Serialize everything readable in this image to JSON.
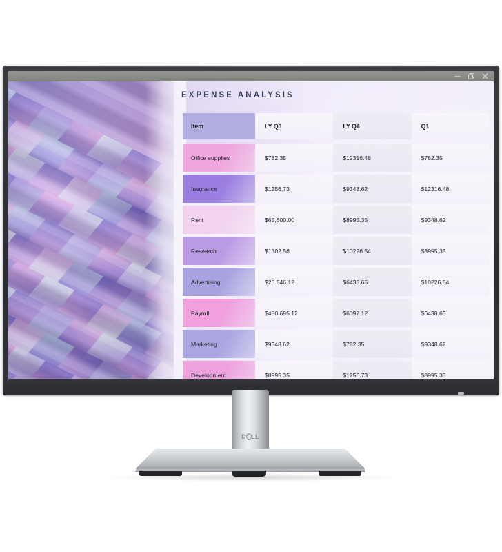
{
  "product": {
    "brand": "DELL",
    "device_name": "monitor"
  },
  "window": {
    "controls": [
      {
        "name": "minimize",
        "glyph": "minimize-icon"
      },
      {
        "name": "maximize",
        "glyph": "maximize-icon"
      },
      {
        "name": "close",
        "glyph": "close-icon"
      }
    ]
  },
  "document": {
    "title": "EXPENSE ANALYSIS",
    "title_color": "#3b4463"
  },
  "table": {
    "headers": [
      "Item",
      "LY Q3",
      "LY Q4",
      "Q1"
    ],
    "header_item_color": "#b3aee2",
    "rows": [
      {
        "item": "Office supplies",
        "color": "#efa6dd",
        "ly_q3": "$782.35",
        "ly_q4": "$12316.48",
        "q1": "$782.35"
      },
      {
        "item": "Insurance",
        "color": "#9a7fe0",
        "ly_q3": "$1256.73",
        "ly_q4": "$9348.62",
        "q1": "$12316.48"
      },
      {
        "item": "Rent",
        "color": "#f2d2ef",
        "ly_q3": "$65,600.00",
        "ly_q4": "$8995.35",
        "q1": "$9348.62"
      },
      {
        "item": "Research",
        "color": "#bb9ae4",
        "ly_q3": "$1302.56",
        "ly_q4": "$10226.54",
        "q1": " $8995.35"
      },
      {
        "item": "Advertising",
        "color": "#a8a3e0",
        "ly_q3": "$26.546.12",
        "ly_q4": "$6438.65",
        "q1": "$10226.54"
      },
      {
        "item": "Payroll",
        "color": "#efa0dd",
        "ly_q3": "$450,695.12",
        "ly_q4": "$6097.12",
        "q1": " $6438.65"
      },
      {
        "item": "Marketing",
        "color": "#aaa6e2",
        "ly_q3": "$9348.62",
        "ly_q4": "$782.35",
        "q1": "$9348.62"
      },
      {
        "item": "Development",
        "color": "#eea2dd",
        "ly_q3": " $8995.35",
        "ly_q4": "$1256.73",
        "q1": "$8995.35"
      }
    ]
  },
  "wallpaper": {
    "description": "abstract-3d-ribbons",
    "palette": [
      "#7c6ad0",
      "#9f84db",
      "#c79ae2",
      "#e0a8e8",
      "#b6c4ec",
      "#d7dcf0",
      "#6f5fc8"
    ]
  }
}
